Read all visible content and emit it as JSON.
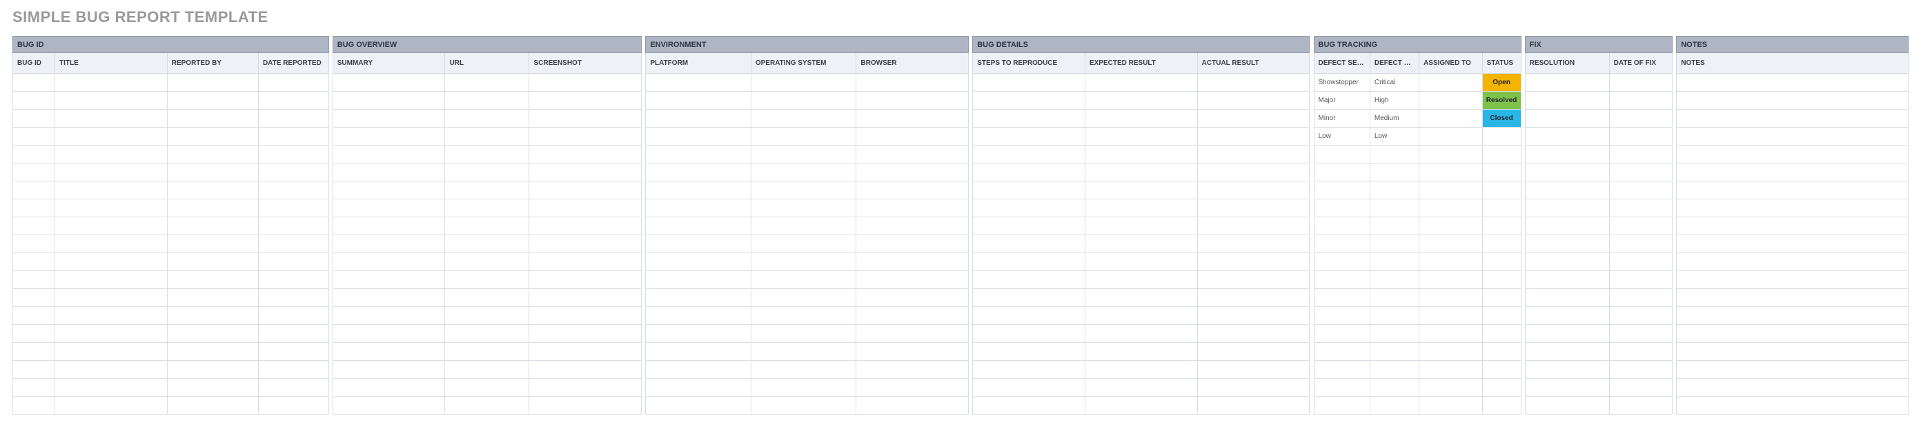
{
  "title": "SIMPLE BUG REPORT TEMPLATE",
  "groups": {
    "bug_id": "BUG ID",
    "bug_overview": "BUG OVERVIEW",
    "environment": "ENVIRONMENT",
    "bug_details": "BUG DETAILS",
    "bug_tracking": "BUG TRACKING",
    "fix": "FIX",
    "notes": "NOTES"
  },
  "columns": {
    "bug_id": "BUG ID",
    "title": "TITLE",
    "reported_by": "REPORTED BY",
    "date_reported": "DATE REPORTED",
    "summary": "SUMMARY",
    "url": "URL",
    "screenshot": "SCREENSHOT",
    "platform": "PLATFORM",
    "operating_system": "OPERATING SYSTEM",
    "browser": "BROWSER",
    "steps_to_reproduce": "STEPS TO REPRODUCE",
    "expected_result": "EXPECTED RESULT",
    "actual_result": "ACTUAL RESULT",
    "defect_severity": "DEFECT SEVERITY",
    "defect_priority": "DEFECT PRIORITY",
    "assigned_to": "ASSIGNED TO",
    "status": "STATUS",
    "resolution": "RESOLUTION",
    "date_of_fix": "DATE OF FIX",
    "notes": "NOTES"
  },
  "example_rows": [
    {
      "defect_severity": "Showstopper",
      "defect_priority": "Critical",
      "status": "Open",
      "status_class": "status-open"
    },
    {
      "defect_severity": "Major",
      "defect_priority": "High",
      "status": "Resolved",
      "status_class": "status-resolved"
    },
    {
      "defect_severity": "Minor",
      "defect_priority": "Medium",
      "status": "Closed",
      "status_class": "status-closed"
    },
    {
      "defect_severity": "Low",
      "defect_priority": "Low",
      "status": "",
      "status_class": ""
    }
  ],
  "blank_rows": 15,
  "col_widths": {
    "bug_id": 60,
    "title": 160,
    "reported_by": 130,
    "date_reported": 100,
    "summary": 160,
    "url": 120,
    "screenshot": 160,
    "platform": 150,
    "operating_system": 150,
    "browser": 160,
    "steps_to_reproduce": 160,
    "expected_result": 160,
    "actual_result": 160,
    "defect_severity": 80,
    "defect_priority": 70,
    "assigned_to": 90,
    "status": 55,
    "resolution": 120,
    "date_of_fix": 90,
    "notes": 330,
    "spacer": 6
  }
}
